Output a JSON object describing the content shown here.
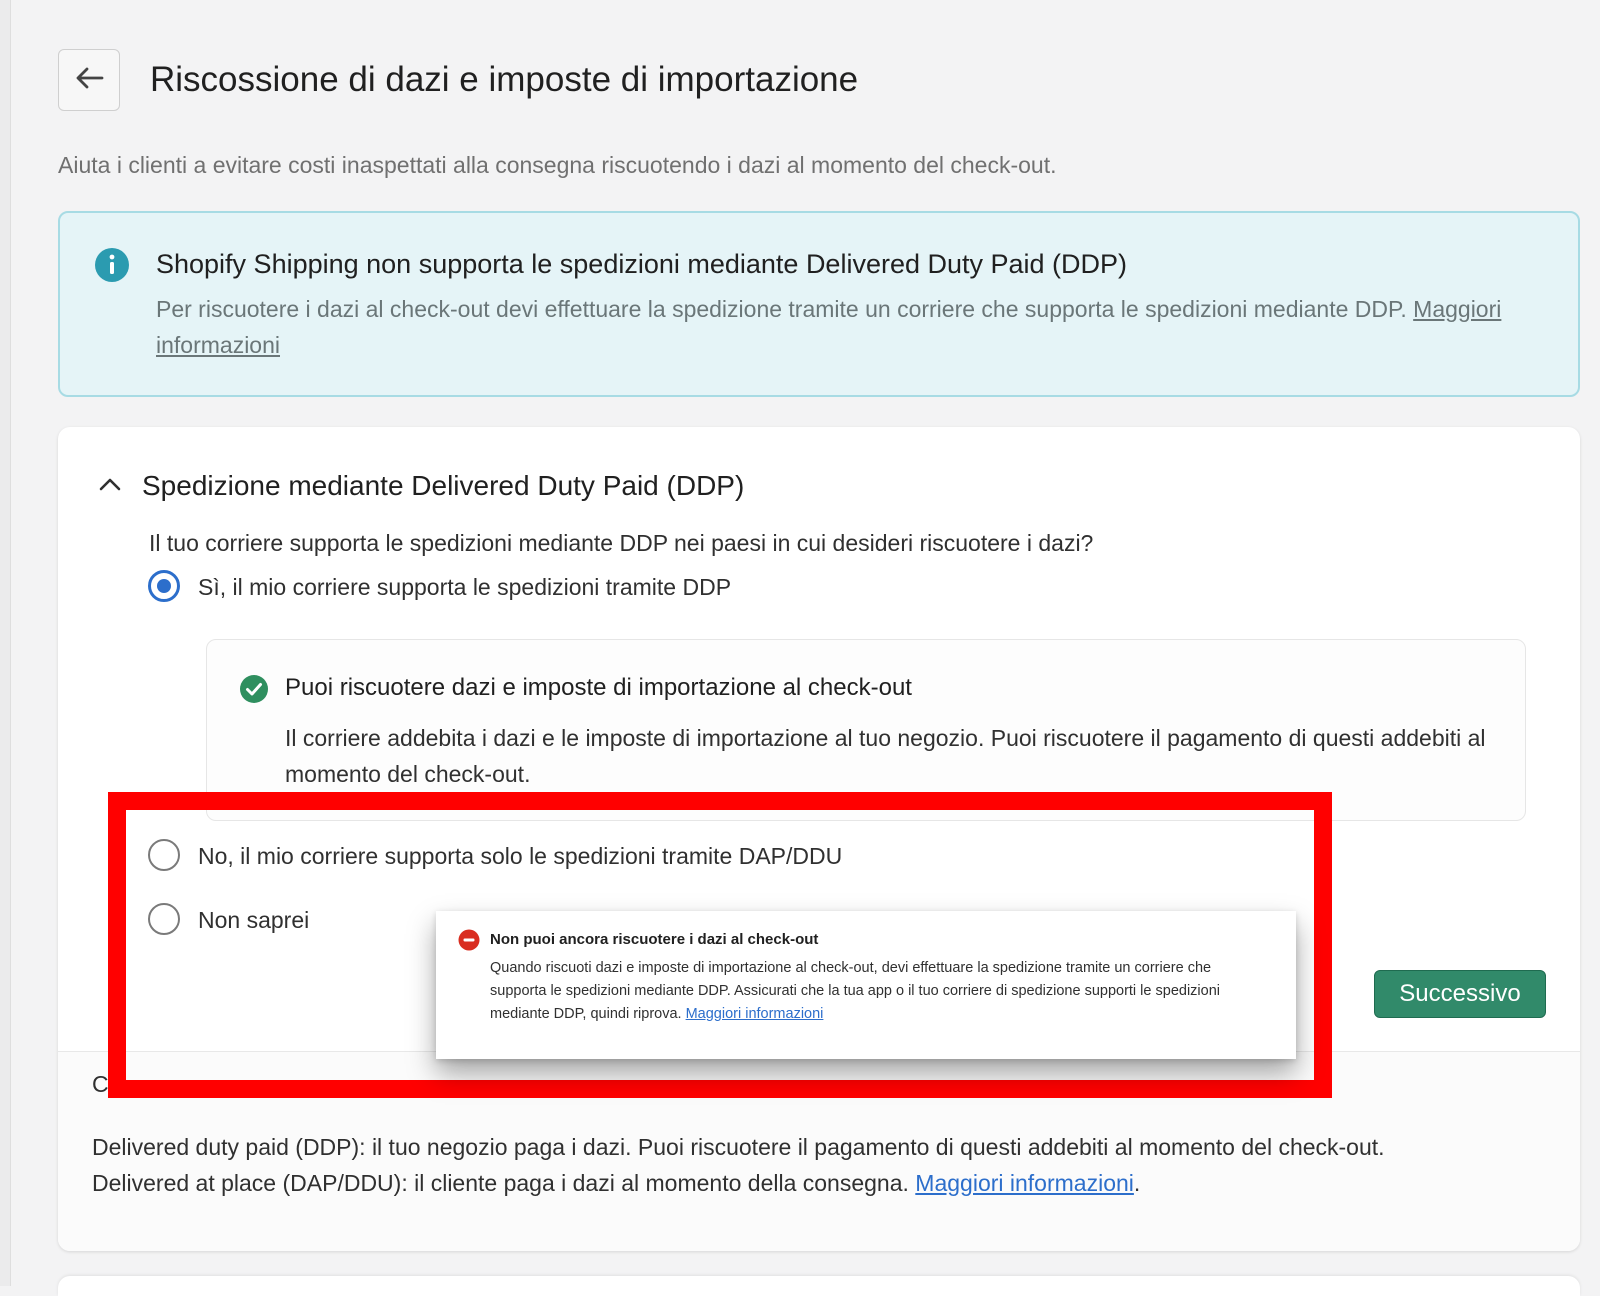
{
  "header": {
    "title": "Riscossione di dazi e imposte di importazione",
    "subtitle": "Aiuta i clienti a evitare costi inaspettati alla consegna riscuotendo i dazi al momento del check-out."
  },
  "info_banner": {
    "icon": "info-icon",
    "title": "Shopify Shipping non supporta le spedizioni mediante Delivered Duty Paid (DDP)",
    "body": "Per riscuotere i dazi al check-out devi effettuare la spedizione tramite un corriere che supporta le spedizioni mediante DDP.",
    "link": "Maggiori informazioni"
  },
  "section": {
    "title": "Spedizione mediante Delivered Duty Paid (DDP)",
    "question": "Il tuo corriere supporta le spedizioni mediante DDP nei paesi in cui desideri riscuotere i dazi?",
    "options": [
      {
        "label": "Sì, il mio corriere supporta le spedizioni tramite DDP",
        "selected": true
      },
      {
        "label": "No, il mio corriere supporta solo le spedizioni tramite DAP/DDU",
        "selected": false
      },
      {
        "label": "Non saprei",
        "selected": false
      }
    ],
    "success": {
      "title": "Puoi riscuotere dazi e imposte di importazione al check-out",
      "body": "Il corriere addebita i dazi e le imposte di importazione al tuo negozio. Puoi riscuotere il pagamento di questi addebiti al momento del check-out."
    },
    "next_label": "Successivo"
  },
  "error_popup": {
    "title": "Non puoi ancora riscuotere i dazi al check-out",
    "body": "Quando riscuoti dazi e imposte di importazione al check-out, devi effettuare la spedizione tramite un corriere che supporta le spedizioni mediante DDP. Assicurati che la tua app o il tuo corriere di spedizione supporti le spedizioni mediante DDP, quindi riprova.",
    "link": "Maggiori informazioni"
  },
  "footer": {
    "partial": "C",
    "line1": "Delivered duty paid (DDP): il tuo negozio paga i dazi. Puoi riscuotere il pagamento di questi addebiti al momento del check-out.",
    "line2": "Delivered at place (DAP/DDU): il cliente paga i dazi al momento della consegna.",
    "link": "Maggiori informazioni",
    "trailing": "."
  },
  "colors": {
    "primary_button": "#318a6a",
    "radio_selected": "#2c6ecb",
    "info_bg": "#e5f4f7",
    "info_icon": "#2b9bb0",
    "success_icon": "#2f8f5f",
    "error_icon": "#d92d20",
    "highlight": "#ff0000"
  }
}
